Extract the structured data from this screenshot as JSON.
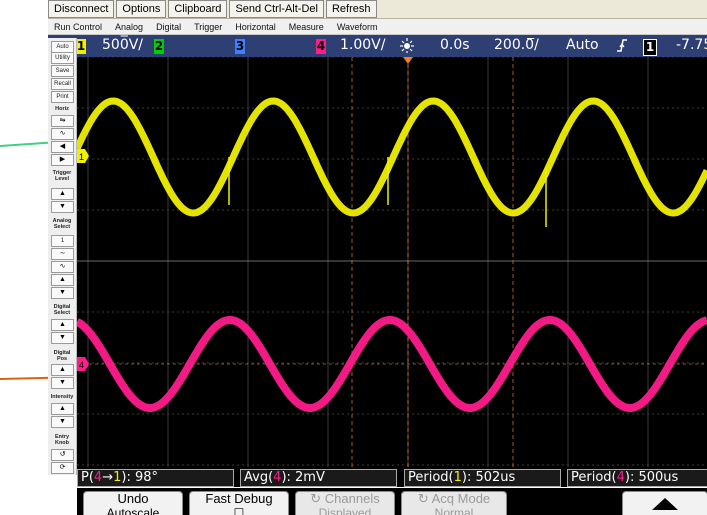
{
  "toolbar": {
    "buttons": [
      "Disconnect",
      "Options",
      "Clipboard",
      "Send Ctrl-Alt-Del",
      "Refresh"
    ]
  },
  "menu": {
    "items": [
      "Run Control",
      "Analog",
      "Digital",
      "Trigger",
      "Horizontal",
      "Measure",
      "Waveform"
    ]
  },
  "status": {
    "ch1_num": "1",
    "ch1_scale": "500̅V/",
    "ch2_num": "2",
    "ch3_num": "3",
    "ch4_num": "4",
    "ch4_scale": "1.00V/",
    "time_offset": "0.0s",
    "time_scale": "200.0̅/",
    "trigger_mode": "Auto",
    "trigger_slope_icon": "rising-edge-icon",
    "trigger_src": "1",
    "trigger_level": "-7.75"
  },
  "left_panel": {
    "buttons": [
      "Auto",
      "Utility",
      "Save",
      "Recall",
      "Print"
    ],
    "labels": [
      "Horiz",
      "Trigger Level",
      "Analog Select",
      "Digital Select",
      "Digital Pos",
      "Intensity",
      "Entry Knob"
    ],
    "analog_select_value": "1"
  },
  "markers": {
    "ch1": "1",
    "ch4": "4"
  },
  "measurements": [
    {
      "prefix": "P(",
      "src_a": "4",
      "arrow": "→",
      "src_b": "1",
      "suffix": "): 98°"
    },
    {
      "prefix": "Avg(",
      "src": "4",
      "suffix": "): 2mV"
    },
    {
      "prefix": "Period(",
      "src": "1",
      "suffix": "): 502us"
    },
    {
      "prefix": "Period(",
      "src": "4",
      "suffix": "): 500us"
    }
  ],
  "softkeys": {
    "undo_line1": "Undo",
    "undo_line2": "Autoscale",
    "fast_debug": "Fast Debug",
    "channels_line1": "Channels",
    "channels_line2": "Displayed",
    "acq_line1": "Acq Mode",
    "acq_line2": "Normal"
  },
  "colors": {
    "ch1": "#f0f000",
    "ch2": "#00d000",
    "ch3": "#3f7fff",
    "ch4": "#ff1c8c",
    "screen_bg": "#000000",
    "grid": "#505050",
    "status_bg": "#2e3f74",
    "trigger_marker": "#f08020",
    "ext_arrow_green": "#40d080",
    "ext_arrow_orange": "#e06010"
  }
}
